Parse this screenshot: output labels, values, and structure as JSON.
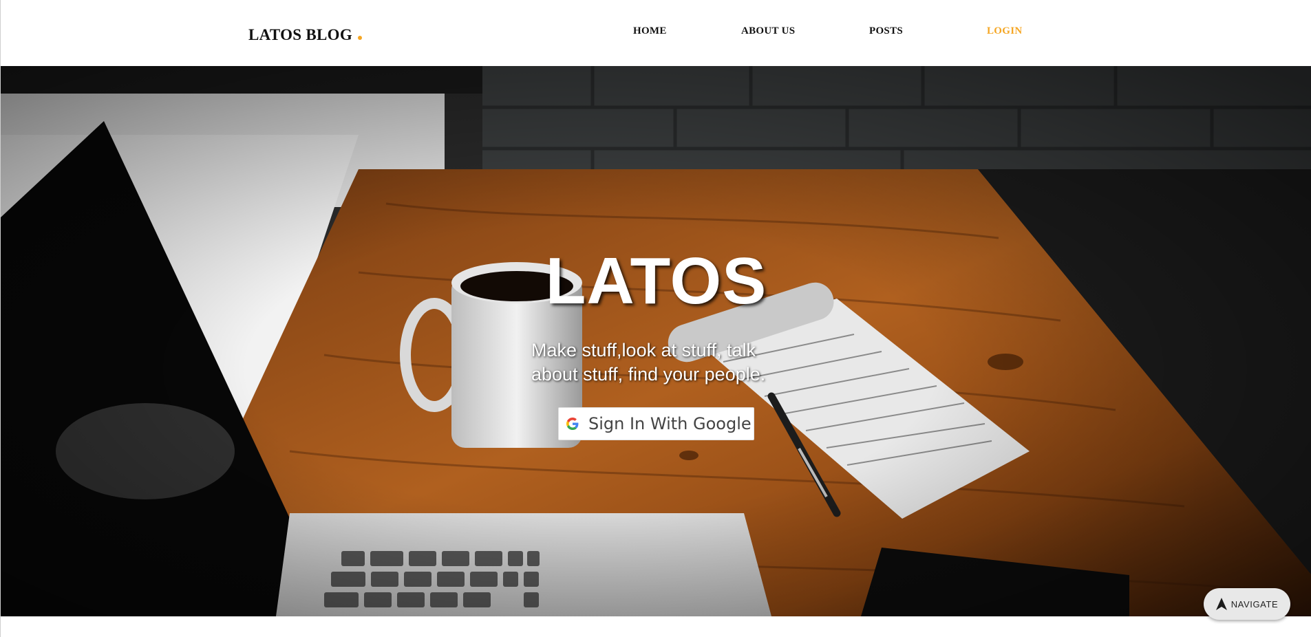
{
  "header": {
    "brand": "LATOS BLOG",
    "nav": [
      {
        "label": "HOME"
      },
      {
        "label": "ABOUT US"
      },
      {
        "label": "POSTS"
      },
      {
        "label": "LOGIN"
      }
    ]
  },
  "hero": {
    "title": "LATOS",
    "subtitle": "Make stuff,look at stuff, talk about stuff, find your people.",
    "google_button_label": "Sign In With Google"
  },
  "fab": {
    "label": "NAVIGATE",
    "icon": "navigation-arrow-icon"
  },
  "colors": {
    "accent": "#f5a623",
    "text_dark": "#111111",
    "hero_text": "#ffffff"
  }
}
